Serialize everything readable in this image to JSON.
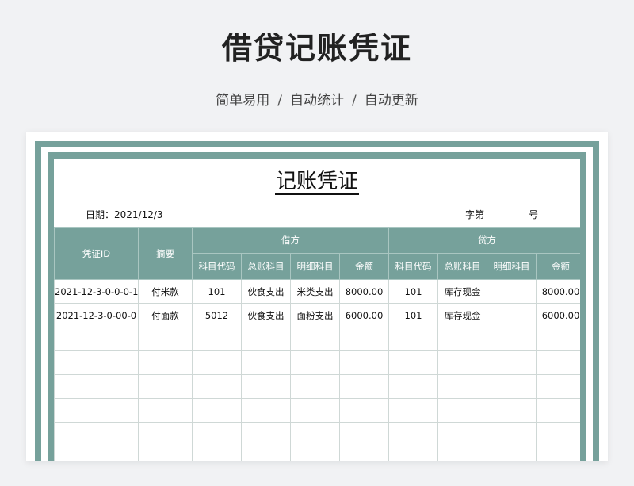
{
  "header": {
    "title": "借贷记账凭证",
    "subtitle_items": [
      "简单易用",
      "自动统计",
      "自动更新"
    ],
    "separator": "/"
  },
  "voucher": {
    "title": "记账凭证",
    "date_label": "日期：",
    "date_value": "2021/12/3",
    "zi_label": "字第",
    "hao_label": "号",
    "columns": {
      "id": "凭证ID",
      "summary": "摘要",
      "debit": "借方",
      "credit": "贷方",
      "sub": [
        "科目代码",
        "总账科目",
        "明细科目",
        "金额",
        "科目代码",
        "总账科目",
        "明细科目",
        "金额"
      ]
    },
    "rows": [
      [
        "2021-12-3-0-0-0-1",
        "付米款",
        "101",
        "伙食支出",
        "米类支出",
        "8000.00",
        "101",
        "库存现金",
        "",
        "8000.00"
      ],
      [
        "2021-12-3-0-00-0",
        "付面款",
        "5012",
        "伙食支出",
        "面粉支出",
        "6000.00",
        "101",
        "库存现金",
        "",
        "6000.00"
      ],
      [
        "",
        "",
        "",
        "",
        "",
        "",
        "",
        "",
        "",
        ""
      ],
      [
        "",
        "",
        "",
        "",
        "",
        "",
        "",
        "",
        "",
        ""
      ],
      [
        "",
        "",
        "",
        "",
        "",
        "",
        "",
        "",
        "",
        ""
      ],
      [
        "",
        "",
        "",
        "",
        "",
        "",
        "",
        "",
        "",
        ""
      ],
      [
        "",
        "",
        "",
        "",
        "",
        "",
        "",
        "",
        "",
        ""
      ],
      [
        "",
        "",
        "",
        "",
        "",
        "",
        "",
        "",
        "",
        ""
      ]
    ]
  },
  "colors": {
    "accent": "#76a19b",
    "background": "#f1f2f4"
  }
}
